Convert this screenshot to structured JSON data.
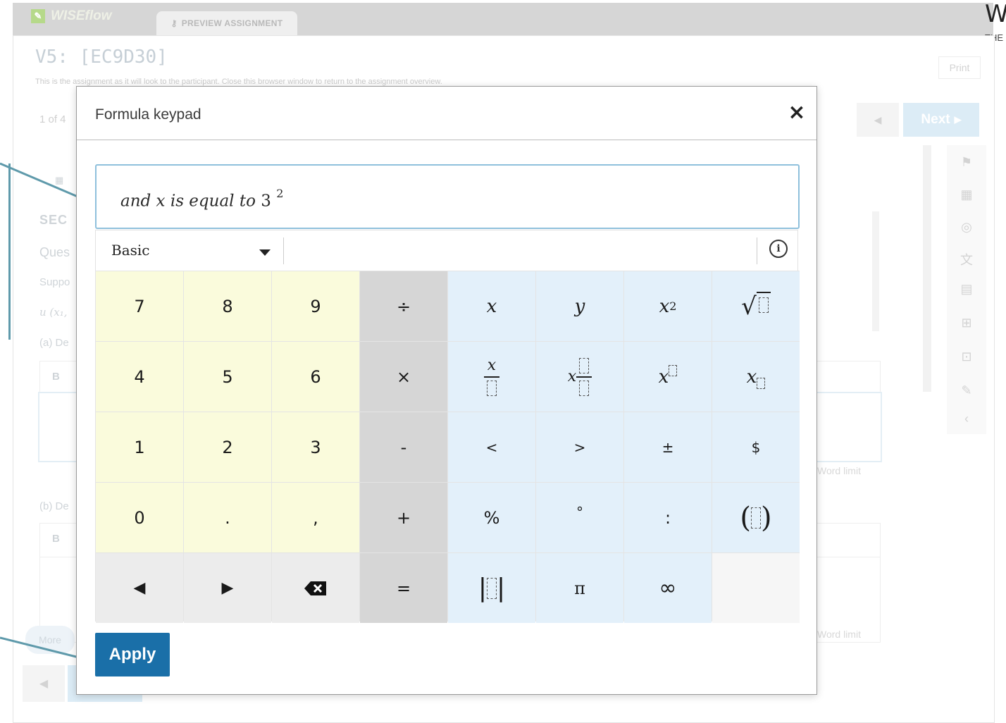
{
  "app": {
    "logo_text": "WISEflow",
    "tab_label": "PREVIEW ASSIGNMENT",
    "corner_letter": "W",
    "corner_sub": "THE"
  },
  "assignment": {
    "title": "V5: [EC9D30]",
    "description": "This is the assignment as it will look to the participant. Close this browser window to return to the assignment overview.",
    "print_label": "Print",
    "page_count": "1 of 4",
    "next_label": "Next"
  },
  "background_fragments": {
    "section": "SEC",
    "question": "Ques",
    "suppose": "Suppo",
    "math": "u (x₁,",
    "part_a": "(a) De",
    "part_b": "(b) De",
    "bold_a": "B",
    "bold_b": "B",
    "word_limit_a": "Word limit",
    "word_limit_b": "Word limit",
    "more": "More"
  },
  "dialog": {
    "title": "Formula keypad",
    "close_symbol": "×",
    "formula": {
      "text": "and x is equal to",
      "base": "3",
      "exponent": "2"
    },
    "keyboard_mode": "Basic",
    "info_symbol": "i",
    "apply_label": "Apply"
  },
  "keys": {
    "k7": "7",
    "k8": "8",
    "k9": "9",
    "div": "÷",
    "x": "x",
    "y": "y",
    "x_sq_base": "x",
    "x_sq_exp": "2",
    "sqrt": "√",
    "k4": "4",
    "k5": "5",
    "k6": "6",
    "mul": "×",
    "frac_num": "x",
    "mixed_x": "x",
    "pow_x": "x",
    "sub_x": "x",
    "k1": "1",
    "k2": "2",
    "k3": "3",
    "minus": "-",
    "lt": "<",
    "gt": ">",
    "pm": "±",
    "dollar": "$",
    "k0": "0",
    "dot": ".",
    "comma": ",",
    "plus": "+",
    "percent": "%",
    "degree": "°",
    "colon": ":",
    "paren_open": "(",
    "paren_close": ")",
    "left": "◀",
    "right": "▶",
    "eq": "=",
    "abs_open": "|",
    "abs_close": "|",
    "pi": "π",
    "inf": "∞"
  },
  "colors": {
    "accent": "#1a6fa8",
    "number_keys": "#fafbdc",
    "operator_keys": "#d6d6d6",
    "symbol_keys": "#e3f0fa",
    "callout": "#5f9aab"
  }
}
